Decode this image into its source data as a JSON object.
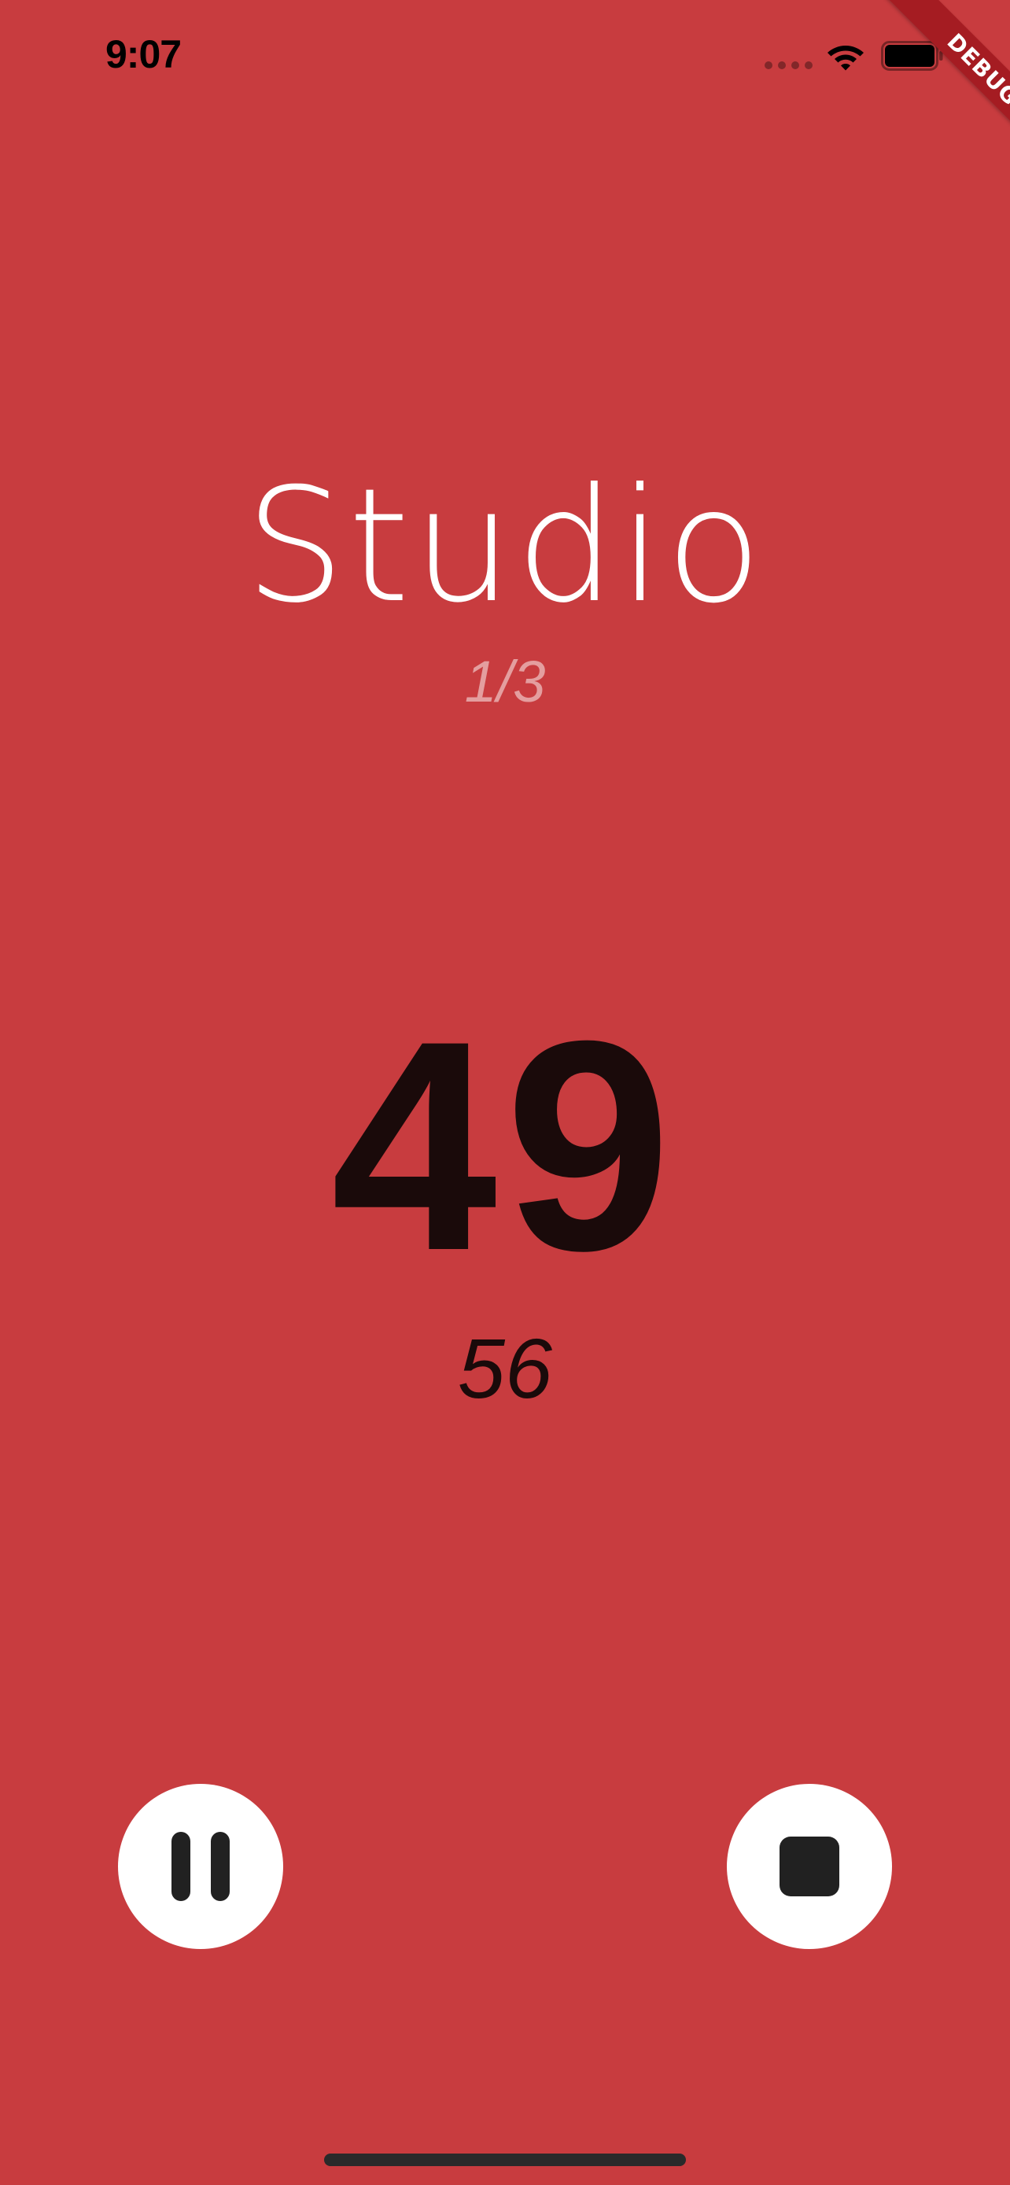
{
  "status_bar": {
    "time": "9:07"
  },
  "debug_banner": {
    "label": "DEBUG"
  },
  "workout": {
    "title": "Studio",
    "progress": "1/3"
  },
  "timer": {
    "main_value": "49",
    "sub_value": "56"
  },
  "controls": {
    "pause_icon": "pause-icon",
    "stop_icon": "stop-icon"
  },
  "colors": {
    "background": "#C83C3F",
    "title_text": "#FFFFFF",
    "timer_text": "#1A0A0A",
    "button_fill": "#FFFFFF",
    "button_icon": "#212121",
    "debug_banner": "#A51C22"
  }
}
